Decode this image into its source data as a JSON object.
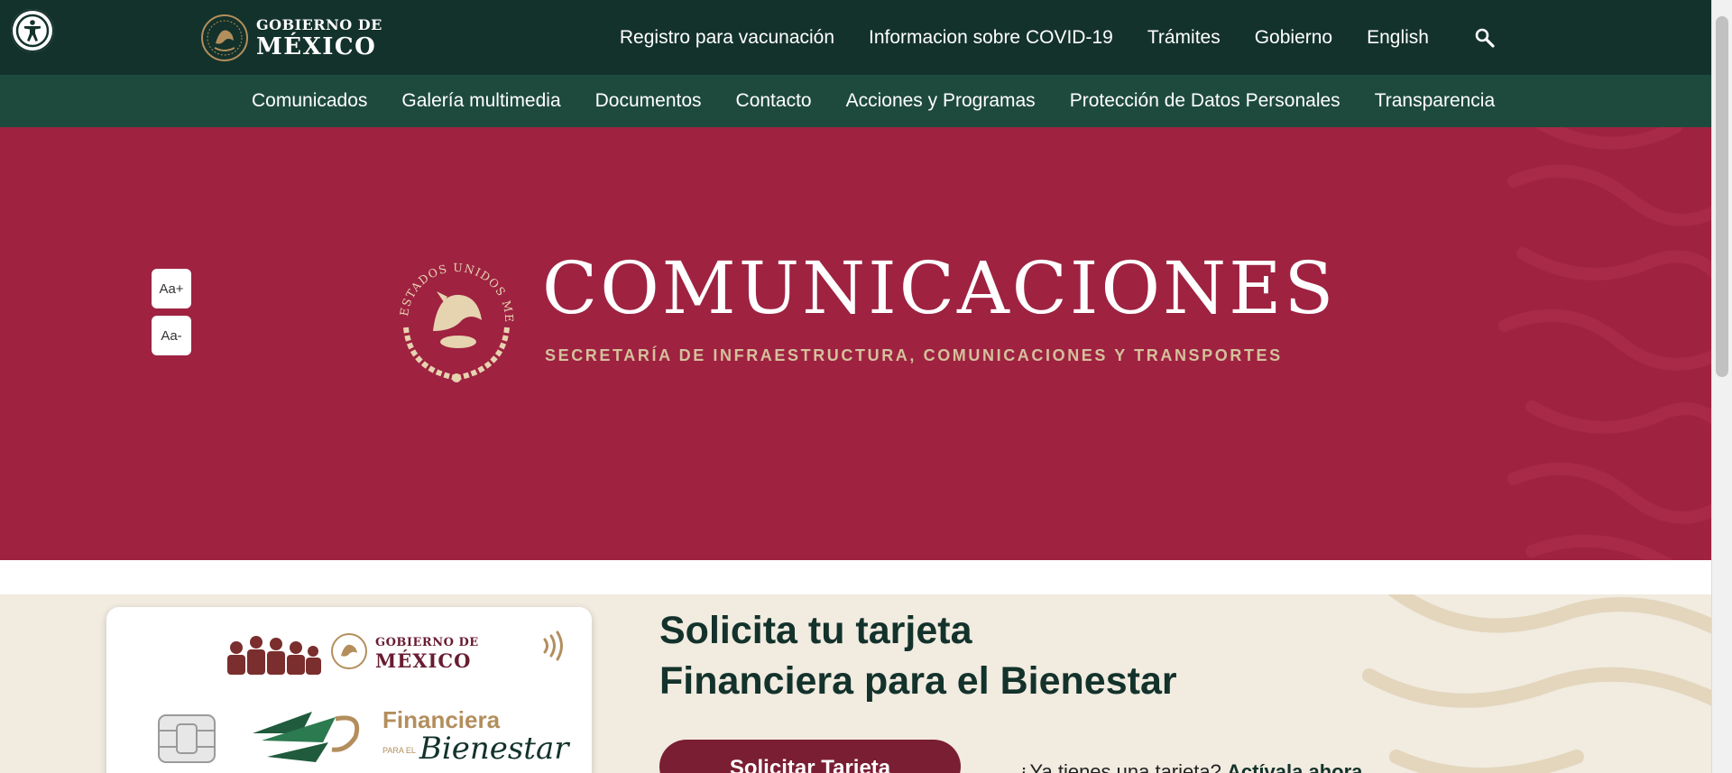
{
  "accessibility": {
    "icon": "accessibility-icon"
  },
  "brand": {
    "line1": "GOBIERNO DE",
    "line2": "MÉXICO"
  },
  "topnav": {
    "items": [
      "Registro para vacunación",
      "Informacion sobre COVID-19",
      "Trámites",
      "Gobierno",
      "English"
    ],
    "search_icon": "search-icon"
  },
  "subnav": {
    "items": [
      "Comunicados",
      "Galería multimedia",
      "Documentos",
      "Contacto",
      "Acciones y Programas",
      "Protección de Datos Personales",
      "Transparencia"
    ]
  },
  "hero": {
    "font_increase": "Aa+",
    "font_decrease": "Aa-",
    "seal_text": "ESTADOS UNIDOS MEXICANOS",
    "title": "COMUNICACIONES",
    "subtitle": "SECRETARÍA DE INFRAESTRUCTURA, COMUNICACIONES Y TRANSPORTES"
  },
  "banner": {
    "title_line1": "Solicita tu tarjeta",
    "title_line2": "Financiera para el Bienestar",
    "button": "Solicitar Tarjeta",
    "question": "¿Ya tienes una tarjeta?",
    "activate_link": "Actívala ahora",
    "card": {
      "gob_line1": "GOBIERNO DE",
      "gob_line2": "MÉXICO",
      "fin_line1": "Financiera",
      "fin_small": "PARA EL",
      "fin_line2": "Bienestar"
    }
  },
  "colors": {
    "topbar": "#13322b",
    "subnav": "#1e4a3e",
    "hero": "#9f2241",
    "gold": "#d4c19c",
    "banner_bg": "#f1ebe0",
    "button": "#7a1e33"
  }
}
